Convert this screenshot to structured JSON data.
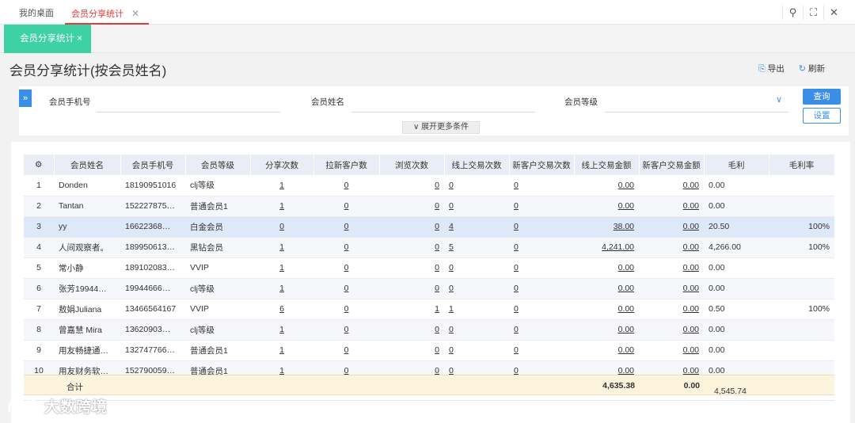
{
  "top_tabs": [
    {
      "label": "我的桌面"
    },
    {
      "label": "会员分享统计"
    }
  ],
  "sub_tab": {
    "label": "会员分享统计 ×"
  },
  "page": {
    "title": "会员分享统计(按会员姓名)",
    "export_label": "导出",
    "refresh_label": "刷新"
  },
  "filter": {
    "phone_label": "会员手机号",
    "name_label": "会员姓名",
    "level_label": "会员等级",
    "more_label": "展开更多条件",
    "query_label": "查询",
    "settings_label": "设置"
  },
  "table": {
    "columns": [
      "会员姓名",
      "会员手机号",
      "会员等级",
      "分享次数",
      "拉新客户数",
      "浏览次数",
      "线上交易次数",
      "新客户交易次数",
      "线上交易金额",
      "新客户交易金额",
      "毛利",
      "毛利率"
    ],
    "rows": [
      {
        "no": "1",
        "name": "Donden",
        "phone": "18190951016",
        "level": "clj等级",
        "share": "1",
        "newcust": "0",
        "views": "0",
        "online_tx": "0",
        "newcust_tx": "0",
        "online_amt": "0.00",
        "newcust_amt": "0.00",
        "profit": "0.00",
        "margin": ""
      },
      {
        "no": "2",
        "name": "Tantan",
        "phone": "152227875…",
        "level": "普通会员1",
        "share": "1",
        "newcust": "0",
        "views": "0",
        "online_tx": "0",
        "newcust_tx": "0",
        "online_amt": "0.00",
        "newcust_amt": "0.00",
        "profit": "0.00",
        "margin": ""
      },
      {
        "no": "3",
        "name": "yy",
        "phone": "16622368…",
        "level": "白金会员",
        "share": "0",
        "newcust": "0",
        "views": "0",
        "online_tx": "4",
        "newcust_tx": "0",
        "online_amt": "38.00",
        "newcust_amt": "0.00",
        "profit": "20.50",
        "margin": "100%"
      },
      {
        "no": "4",
        "name": "人间观察者。",
        "phone": "189950613…",
        "level": "黑钻会员",
        "share": "1",
        "newcust": "0",
        "views": "0",
        "online_tx": "5",
        "newcust_tx": "0",
        "online_amt": "4,241.00",
        "newcust_amt": "0.00",
        "profit": "4,266.00",
        "margin": "100%"
      },
      {
        "no": "5",
        "name": "常小静",
        "phone": "189102083…",
        "level": "VVIP",
        "share": "1",
        "newcust": "0",
        "views": "0",
        "online_tx": "0",
        "newcust_tx": "0",
        "online_amt": "0.00",
        "newcust_amt": "0.00",
        "profit": "0.00",
        "margin": ""
      },
      {
        "no": "6",
        "name": "张芳19944…",
        "phone": "19944666…",
        "level": "clj等级",
        "share": "1",
        "newcust": "0",
        "views": "0",
        "online_tx": "0",
        "newcust_tx": "0",
        "online_amt": "0.00",
        "newcust_amt": "0.00",
        "profit": "0.00",
        "margin": ""
      },
      {
        "no": "7",
        "name": "敖娟Juliana",
        "phone": "13466564167",
        "level": "VVIP",
        "share": "6",
        "newcust": "0",
        "views": "1",
        "online_tx": "1",
        "newcust_tx": "0",
        "online_amt": "0.00",
        "newcust_amt": "0.00",
        "profit": "0.50",
        "margin": "100%"
      },
      {
        "no": "8",
        "name": "曾嘉慧 Mira",
        "phone": "13620903…",
        "level": "clj等级",
        "share": "1",
        "newcust": "0",
        "views": "0",
        "online_tx": "0",
        "newcust_tx": "0",
        "online_amt": "0.00",
        "newcust_amt": "0.00",
        "profit": "0.00",
        "margin": ""
      },
      {
        "no": "9",
        "name": "用友畅捷通…",
        "phone": "132747766…",
        "level": "普通会员1",
        "share": "1",
        "newcust": "0",
        "views": "0",
        "online_tx": "0",
        "newcust_tx": "0",
        "online_amt": "0.00",
        "newcust_amt": "0.00",
        "profit": "0.00",
        "margin": ""
      },
      {
        "no": "10",
        "name": "用友财务软…",
        "phone": "152790059…",
        "level": "普通会员1",
        "share": "1",
        "newcust": "0",
        "views": "0",
        "online_tx": "0",
        "newcust_tx": "0",
        "online_amt": "0.00",
        "newcust_amt": "0.00",
        "profit": "0.00",
        "margin": ""
      }
    ],
    "total": {
      "label": "合计",
      "online_amt": "4,635.38",
      "newcust_amt": "0.00",
      "profit": "4,545.74"
    }
  },
  "watermark": {
    "text": "大数跨境"
  },
  "colors": {
    "accent": "#3a8ee6",
    "tab_active": "#3dd1a4",
    "top_tab_active": "#e23b3b",
    "highlight_row": "#dde9f8",
    "total_row": "#fbf3dc"
  }
}
